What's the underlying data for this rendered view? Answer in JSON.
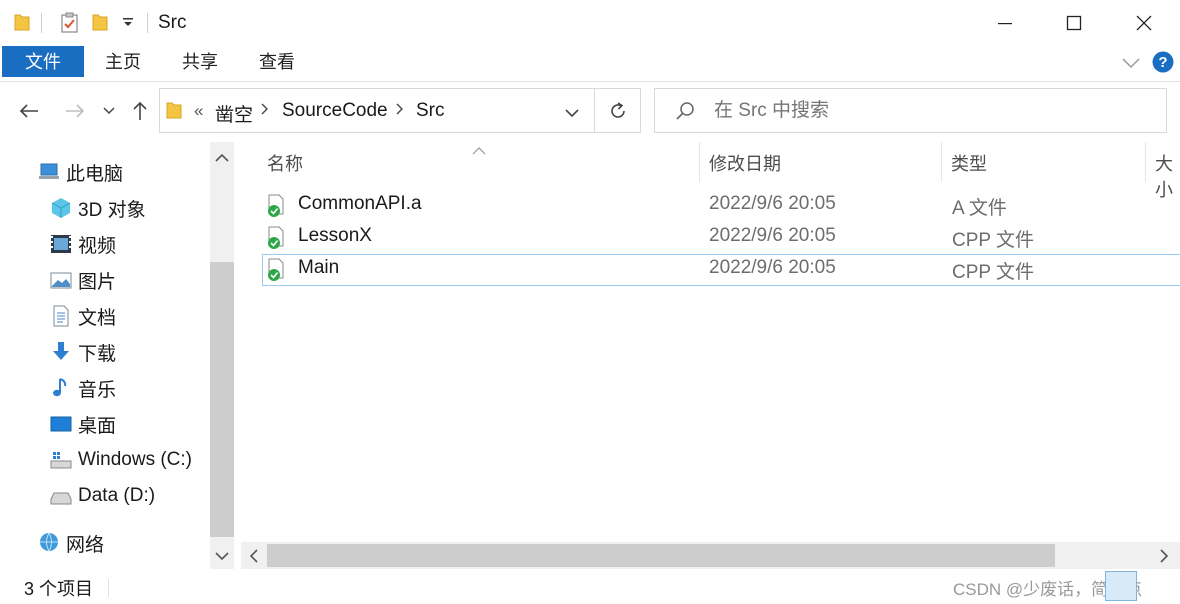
{
  "window": {
    "title": "Src"
  },
  "ribbon": {
    "tabs": [
      "文件",
      "主页",
      "共享",
      "查看"
    ]
  },
  "address": {
    "overflow": "«",
    "crumbs": [
      "凿空",
      "SourceCode",
      "Src"
    ]
  },
  "search": {
    "placeholder": "在 Src 中搜索"
  },
  "sidebar": {
    "items": [
      {
        "label": "此电脑",
        "icon": "computer-icon"
      },
      {
        "label": "3D 对象",
        "icon": "3d-objects-icon"
      },
      {
        "label": "视频",
        "icon": "video-icon"
      },
      {
        "label": "图片",
        "icon": "pictures-icon"
      },
      {
        "label": "文档",
        "icon": "documents-icon"
      },
      {
        "label": "下载",
        "icon": "download-icon"
      },
      {
        "label": "音乐",
        "icon": "music-icon"
      },
      {
        "label": "桌面",
        "icon": "desktop-icon"
      },
      {
        "label": "Windows (C:)",
        "icon": "drive-c-icon"
      },
      {
        "label": "Data (D:)",
        "icon": "drive-d-icon"
      },
      {
        "label": "网络",
        "icon": "network-icon"
      }
    ]
  },
  "columns": {
    "name": "名称",
    "modified": "修改日期",
    "type": "类型",
    "size": "大小"
  },
  "files": [
    {
      "name": "CommonAPI.a",
      "modified": "2022/9/6 20:05",
      "type": "A 文件",
      "selected": false
    },
    {
      "name": "LessonX",
      "modified": "2022/9/6 20:05",
      "type": "CPP 文件",
      "selected": false
    },
    {
      "name": "Main",
      "modified": "2022/9/6 20:05",
      "type": "CPP 文件",
      "selected": true
    }
  ],
  "status": {
    "item_count": "3 个项目"
  },
  "watermark": "CSDN @少废话，简明点",
  "colors": {
    "accent": "#1a6ec2",
    "selection_border": "#99c9ef",
    "folder": "#f4c542",
    "sync_ok": "#2ea84a"
  }
}
